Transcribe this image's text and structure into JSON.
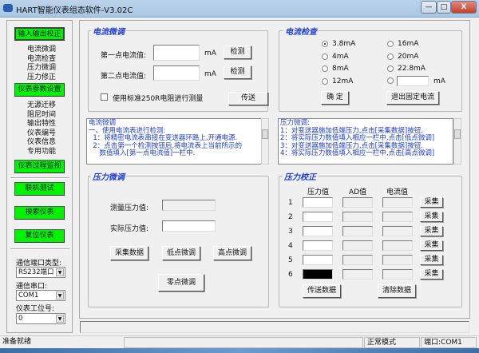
{
  "window": {
    "title": "HART智能仪表组态软件-V3.02C",
    "min": "—",
    "max": "□",
    "close": "X"
  },
  "sidebar": {
    "sections": [
      {
        "label": "输入输出校正",
        "items": [
          "电流微调",
          "电流检查",
          "压力微调",
          "压力修正"
        ]
      },
      {
        "label": "仪表参数设置",
        "items": [
          "无源迁移",
          "阻尼时间",
          "输出特性",
          "仪表编号",
          "仪表信息",
          "专用功能"
        ]
      },
      {
        "label": "仪表过程监视",
        "items": []
      }
    ],
    "actions": [
      "联机测试",
      "搜索仪表",
      "复位仪表"
    ],
    "port_type_label": "通信端口类型:",
    "port_type_value": "RS232端口",
    "serial_label": "通信串口:",
    "serial_value": "COM1",
    "station_label": "仪表工位号:",
    "station_value": "0",
    "dropdown_arrow": "▼"
  },
  "current_trim": {
    "title": "电流微调",
    "first_label": "第一点电流值:",
    "second_label": "第二点电流值:",
    "unit": "mA",
    "detect": "检测",
    "checkbox_label": "使用标准250R电阻进行测量",
    "checked": false,
    "send": "传送"
  },
  "current_check": {
    "title": "电流检查",
    "options": [
      "3.8mA",
      "4mA",
      "8mA",
      "12mA",
      "16mA",
      "20mA",
      "22.8mA"
    ],
    "selected": "3.8mA",
    "custom_unit": "mA",
    "confirm": "确 定",
    "exit": "退出固定电流"
  },
  "help_left": [
    "电流微调",
    "一、使用电流表进行检测:",
    "  1：将精密电流表串接在变送器环路上,开通电源.",
    "  2：点击第一个检测按钮后,将电流表上当前所示的",
    "     数值填入[第一点电流值]一栏中."
  ],
  "help_right": [
    "压力微调:",
    "1：对变送器施加低端压力,点击[采集数据]按钮.",
    "2：将实际压力数值填入相应一栏中,点击[低点微调]",
    "3：对变送器施加低端压力,点击[采集数据]按钮.",
    "4：将实际压力数值填入相应一栏中,点击[高点微调]"
  ],
  "pressure_trim": {
    "title": "压力微调",
    "measured_label": "测量压力值:",
    "actual_label": "实际压力值:",
    "collect": "采集数据",
    "low": "低点微调",
    "high": "高点微调",
    "zero": "零点微调"
  },
  "pressure_cal": {
    "title": "压力校正",
    "headers": [
      "压力值",
      "AD值",
      "电流值"
    ],
    "rows": [
      "1",
      "2",
      "3",
      "4",
      "5",
      "6"
    ],
    "collect": "采集",
    "send": "传送数据",
    "clear": "清除数据"
  },
  "statusbar": {
    "ready": "准备就绪",
    "mode": "正常模式",
    "port": "端口:COM1"
  },
  "watermark": {
    "text": "脚本之家",
    "url": "www.jb51.net"
  }
}
